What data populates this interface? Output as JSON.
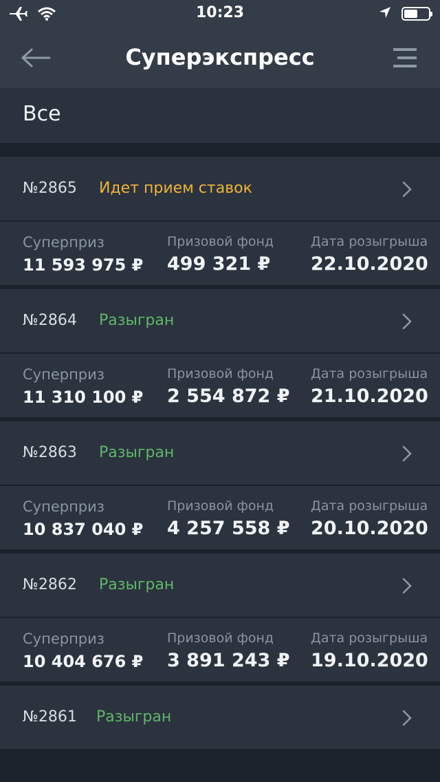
{
  "status_bar": {
    "time": "10:23",
    "icons": [
      "airplane-icon",
      "wifi-icon",
      "location-icon",
      "battery-icon"
    ]
  },
  "header": {
    "title": "Суперэкспресс",
    "back_icon": "arrow-left-icon",
    "menu_icon": "menu-icon"
  },
  "filter": {
    "label": "Все"
  },
  "colors": {
    "accent_pending": "#f0b33a",
    "accent_done": "#5fb66a",
    "background": "#1b222b",
    "card": "#2b333e",
    "header": "#333c47"
  },
  "columns": {
    "superprize": "Суперприз",
    "fund": "Призовой фонд",
    "date": "Дата розыгрыша"
  },
  "draws": [
    {
      "number": "№2865",
      "status": "Идет прием ставок",
      "status_kind": "pending",
      "superprize": "11 593 975 ₽",
      "fund": "499 321 ₽",
      "date": "22.10.2020"
    },
    {
      "number": "№2864",
      "status": "Разыгран",
      "status_kind": "done",
      "superprize": "11 310 100 ₽",
      "fund": "2 554 872 ₽",
      "date": "21.10.2020"
    },
    {
      "number": "№2863",
      "status": "Разыгран",
      "status_kind": "done",
      "superprize": "10 837 040 ₽",
      "fund": "4 257 558 ₽",
      "date": "20.10.2020"
    },
    {
      "number": "№2862",
      "status": "Разыгран",
      "status_kind": "done",
      "superprize": "10 404 676 ₽",
      "fund": "3 891 243 ₽",
      "date": "19.10.2020"
    },
    {
      "number": "№2861",
      "status": "Разыгран",
      "status_kind": "done"
    }
  ]
}
